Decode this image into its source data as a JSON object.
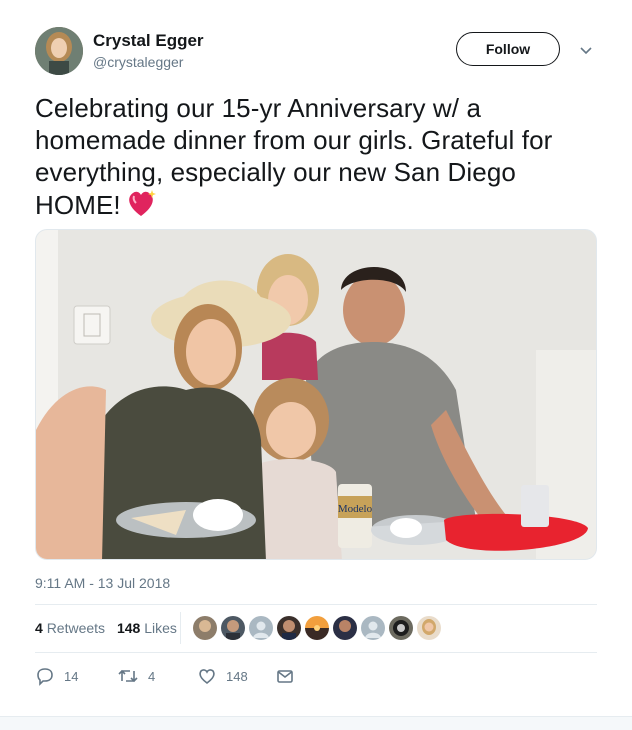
{
  "author": {
    "name": "Crystal Egger",
    "handle": "@crystalegger"
  },
  "follow_label": "Follow",
  "tweet": {
    "text": "Celebrating our 15-yr Anniversary w/ a homemade dinner from our girls.  Grateful for everything, especially our new San Diego HOME!",
    "emoji": "sparkling-heart-icon"
  },
  "photo": {
    "can_label": "Modelo"
  },
  "timestamp": "9:11 AM - 13 Jul 2018",
  "stats": {
    "retweets_count": "4",
    "retweets_label": "Retweets",
    "likes_count": "148",
    "likes_label": "Likes"
  },
  "actions": {
    "replies": "14",
    "retweets": "4",
    "likes": "148"
  },
  "colors": {
    "text": "#14171a",
    "secondary": "#657786",
    "divider": "#e6ecf0",
    "heart": "#e0245e"
  }
}
